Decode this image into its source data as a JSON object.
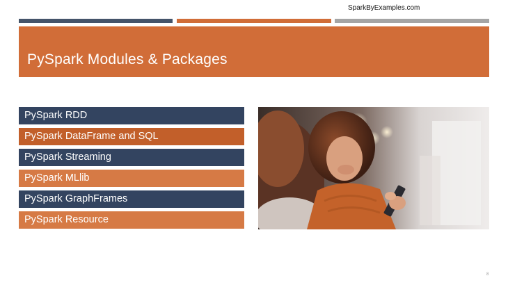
{
  "watermark": "SparkByExamples.com",
  "slide": {
    "title": "PySpark Modules & Packages",
    "page_number": "8",
    "colors": {
      "accent": "#d16d38",
      "dark": "#44546a",
      "grey": "#a5a5a5"
    }
  },
  "modules": [
    {
      "label": "PySpark RDD",
      "color": "#334460"
    },
    {
      "label": "PySpark DataFrame and SQL",
      "color": "#c25f2a"
    },
    {
      "label": "PySpark Streaming",
      "color": "#334460"
    },
    {
      "label": "PySpark MLlib",
      "color": "#d67a45"
    },
    {
      "label": "PySpark GraphFrames",
      "color": "#334460"
    },
    {
      "label": "PySpark Resource",
      "color": "#d67a45"
    }
  ]
}
